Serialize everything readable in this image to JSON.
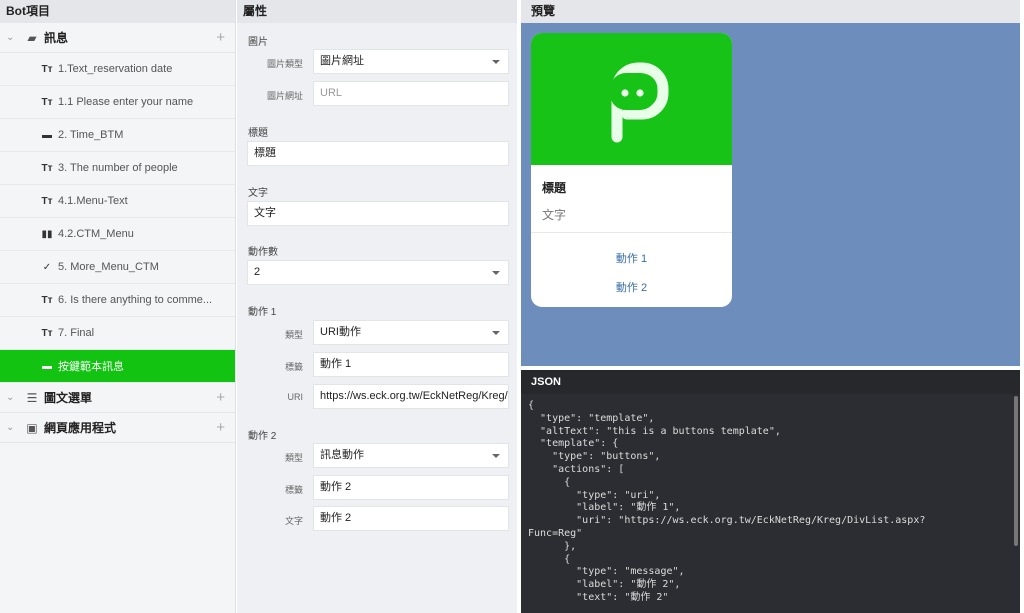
{
  "left_panel": {
    "title": "Bot項目",
    "groups": [
      {
        "label": "訊息",
        "icon": "message-icon"
      },
      {
        "label": "圖文選單",
        "icon": "list-icon"
      },
      {
        "label": "網頁應用程式",
        "icon": "app-window-icon"
      }
    ],
    "items": [
      {
        "label": "1.Text_reservation date",
        "icon": "Tт"
      },
      {
        "label": "1.1 Please enter your name",
        "icon": "Tт"
      },
      {
        "label": "2. Time_BTM",
        "icon": "▬"
      },
      {
        "label": "3. The number of people",
        "icon": "Tт"
      },
      {
        "label": "4.1.Menu-Text",
        "icon": "Tт"
      },
      {
        "label": "4.2.CTM_Menu",
        "icon": "▮▮"
      },
      {
        "label": "5. More_Menu_CTM",
        "icon": "✓"
      },
      {
        "label": "6. Is there anything to comme...",
        "icon": "Tт"
      },
      {
        "label": "7. Final",
        "icon": "Tт"
      },
      {
        "label": "按鍵範本訊息",
        "icon": "▬"
      }
    ]
  },
  "properties": {
    "title": "屬性",
    "image_section": "圖片",
    "image_type_label": "圖片類型",
    "image_type_value": "圖片網址",
    "image_url_label": "圖片網址",
    "image_url_placeholder": "URL",
    "title_section": "標題",
    "title_value": "標題",
    "text_section": "文字",
    "text_value": "文字",
    "action_count_section": "動作數",
    "action_count_value": "2",
    "action1": {
      "section": "動作 1",
      "type_label": "類型",
      "type_value": "URI動作",
      "label_label": "標籤",
      "label_value": "動作 1",
      "uri_label": "URI",
      "uri_value": "https://ws.eck.org.tw/EckNetReg/Kreg/DivList.aspx?Func=Reg"
    },
    "action2": {
      "section": "動作 2",
      "type_label": "類型",
      "type_value": "訊息動作",
      "label_label": "標籤",
      "label_value": "動作 2",
      "text_label": "文字",
      "text_value": "動作 2"
    }
  },
  "preview": {
    "title": "預覽",
    "card_title": "標題",
    "card_text": "文字",
    "button1": "動作 1",
    "button2": "動作 2",
    "brand_color": "#16c316",
    "background_color": "#6d8ebc"
  },
  "json_panel": {
    "title": "JSON",
    "content": "{\n  \"type\": \"template\",\n  \"altText\": \"this is a buttons template\",\n  \"template\": {\n    \"type\": \"buttons\",\n    \"actions\": [\n      {\n        \"type\": \"uri\",\n        \"label\": \"動作 1\",\n        \"uri\": \"https://ws.eck.org.tw/EckNetReg/Kreg/DivList.aspx?\nFunc=Reg\"\n      },\n      {\n        \"type\": \"message\",\n        \"label\": \"動作 2\",\n        \"text\": \"動作 2\""
  }
}
